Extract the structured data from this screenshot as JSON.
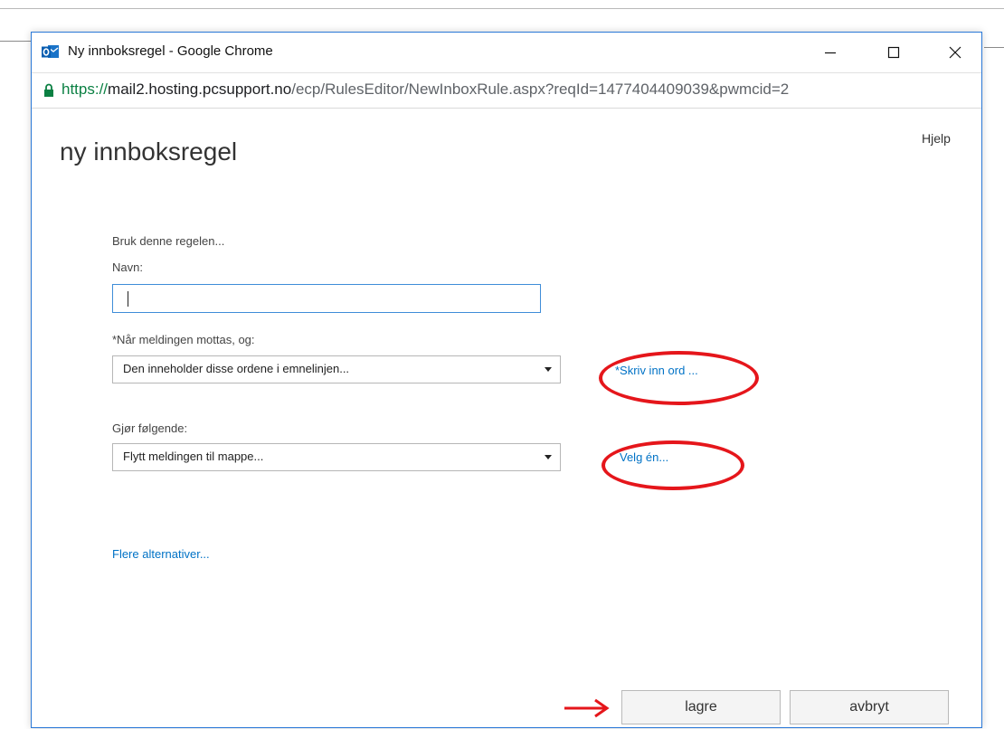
{
  "window": {
    "title": "Ny innboksregel - Google Chrome",
    "icon": "outlook-icon"
  },
  "address": {
    "scheme": "https://",
    "host": "mail2.hosting.pcsupport.no",
    "path": "/ecp/RulesEditor/NewInboxRule.aspx?reqId=1477404409039&pwmcid=2"
  },
  "page": {
    "title": "ny innboksregel",
    "help_label": "Hjelp"
  },
  "form": {
    "intro_label": "Bruk denne regelen...",
    "name_label": "Navn:",
    "name_value": "",
    "condition_label": "*Når meldingen mottas, og:",
    "condition_selected": "Den inneholder disse ordene i emnelinjen...",
    "condition_link": "*Skriv inn ord ...",
    "action_label": "Gjør følgende:",
    "action_selected": "Flytt meldingen til mappe...",
    "action_link": "Velg én...",
    "more_options_link": "Flere alternativer..."
  },
  "buttons": {
    "save_label": "lagre",
    "cancel_label": "avbryt"
  },
  "annotations": {
    "highlight_color": "#e5161b"
  },
  "colors": {
    "link": "#0072c6",
    "window_border": "#2b79d8",
    "input_focus": "#3f8dd8"
  }
}
